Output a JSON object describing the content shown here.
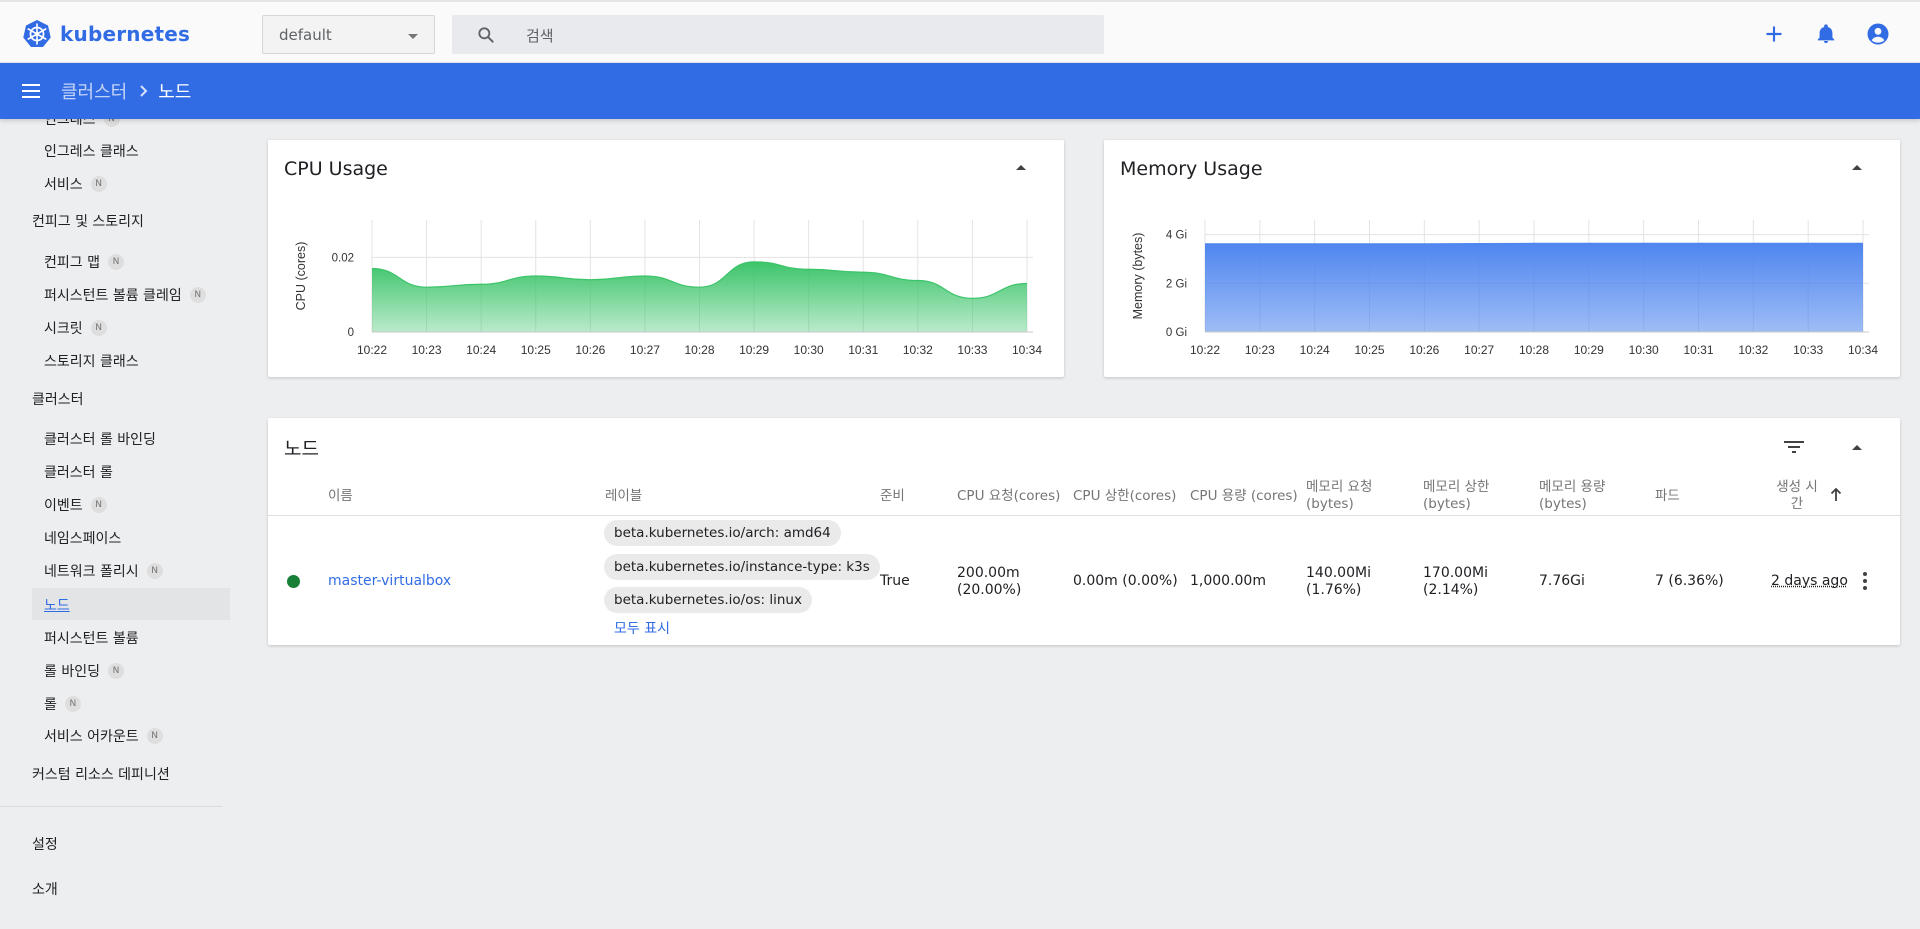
{
  "app": {
    "name": "kubernetes"
  },
  "toolbar": {
    "namespace_value": "default",
    "search_placeholder": "검색"
  },
  "breadcrumb": {
    "parent": "클러스터",
    "current": "노드"
  },
  "sidebar": {
    "partial_top_label": "인그레스",
    "items": [
      {
        "label": "인그레스 클래스",
        "badge": ""
      },
      {
        "label": "서비스",
        "badge": "N"
      }
    ],
    "config_header": "컨피그 및 스토리지",
    "config_items": [
      {
        "label": "컨피그 맵",
        "badge": "N"
      },
      {
        "label": "퍼시스턴트 볼륨 클레임",
        "badge": "N"
      },
      {
        "label": "시크릿",
        "badge": "N"
      },
      {
        "label": "스토리지 클래스",
        "badge": ""
      }
    ],
    "cluster_header": "클러스터",
    "cluster_items": [
      {
        "label": "클러스터 롤 바인딩",
        "badge": ""
      },
      {
        "label": "클러스터 롤",
        "badge": ""
      },
      {
        "label": "이벤트",
        "badge": "N"
      },
      {
        "label": "네임스페이스",
        "badge": ""
      },
      {
        "label": "네트워크 폴리시",
        "badge": "N"
      },
      {
        "label": "노드",
        "badge": ""
      },
      {
        "label": "퍼시스턴트 볼륨",
        "badge": ""
      },
      {
        "label": "롤 바인딩",
        "badge": "N"
      },
      {
        "label": "롤",
        "badge": "N"
      },
      {
        "label": "서비스 어카운트",
        "badge": "N"
      }
    ],
    "crd_header": "커스텀 리소스 데피니션",
    "settings": "설정",
    "about": "소개"
  },
  "cpu_card": {
    "title": "CPU Usage"
  },
  "memory_card": {
    "title": "Memory Usage"
  },
  "chart_data": [
    {
      "type": "area",
      "title": "CPU Usage",
      "xlabel": "",
      "ylabel": "CPU (cores)",
      "x": [
        "10:22",
        "10:23",
        "10:24",
        "10:25",
        "10:26",
        "10:27",
        "10:28",
        "10:29",
        "10:30",
        "10:31",
        "10:32",
        "10:33",
        "10:34"
      ],
      "values": [
        0.017,
        0.012,
        0.0128,
        0.015,
        0.014,
        0.015,
        0.012,
        0.0188,
        0.0168,
        0.016,
        0.0138,
        0.009,
        0.013
      ],
      "yticks": [
        "0",
        "0.02"
      ],
      "ylim": [
        0,
        0.03
      ],
      "grid": true,
      "color": "#3cc46a"
    },
    {
      "type": "area",
      "title": "Memory Usage",
      "xlabel": "",
      "ylabel": "Memory (bytes)",
      "x": [
        "10:22",
        "10:23",
        "10:24",
        "10:25",
        "10:26",
        "10:27",
        "10:28",
        "10:29",
        "10:30",
        "10:31",
        "10:32",
        "10:33",
        "10:34"
      ],
      "values": [
        3.62,
        3.62,
        3.62,
        3.62,
        3.62,
        3.63,
        3.64,
        3.64,
        3.64,
        3.64,
        3.64,
        3.64,
        3.64
      ],
      "yticks": [
        "0 Gi",
        "2 Gi",
        "4 Gi"
      ],
      "ylim": [
        0,
        4.6
      ],
      "grid": true,
      "color": "#4f86ef"
    }
  ],
  "nodes_card": {
    "title": "노드",
    "headers": {
      "name": "이름",
      "labels": "레이블",
      "ready": "준비",
      "cpu_req": "CPU 요청(cores)",
      "cpu_limit": "CPU 상한(cores)",
      "cpu_cap": "CPU 용량 (cores)",
      "mem_req_1": "메모리 요청",
      "mem_req_2": "(bytes)",
      "mem_limit_1": "메모리 상한",
      "mem_limit_2": "(bytes)",
      "mem_cap_1": "메모리 용량",
      "mem_cap_2": "(bytes)",
      "pods": "파드",
      "created_1": "생성 시",
      "created_2": "간"
    },
    "rows": [
      {
        "status_color": "#188038",
        "name": "master-virtualbox",
        "labels": [
          "beta.kubernetes.io/arch: amd64",
          "beta.kubernetes.io/instance-type: k3s",
          "beta.kubernetes.io/os: linux"
        ],
        "show_all": "모두 표시",
        "ready": "True",
        "cpu_req_1": "200.00m",
        "cpu_req_2": "(20.00%)",
        "cpu_limit": "0.00m (0.00%)",
        "cpu_cap": "1,000.00m",
        "mem_req_1": "140.00Mi",
        "mem_req_2": "(1.76%)",
        "mem_limit_1": "170.00Mi",
        "mem_limit_2": "(2.14%)",
        "mem_cap": "7.76Gi",
        "pods": "7 (6.36%)",
        "created": "2 days ago"
      }
    ]
  }
}
